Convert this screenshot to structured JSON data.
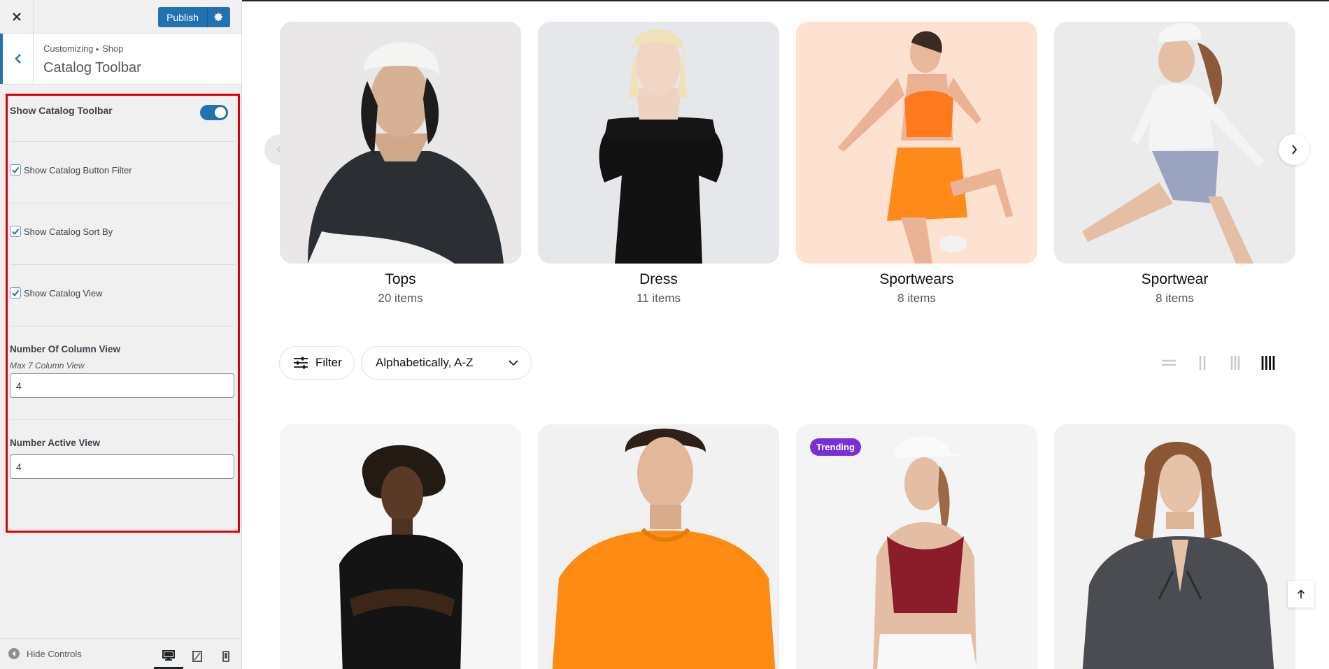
{
  "sidebar": {
    "publish_label": "Publish",
    "breadcrumb": {
      "root": "Customizing",
      "section": "Shop"
    },
    "section_title": "Catalog Toolbar",
    "controls": {
      "show_toolbar": {
        "label": "Show Catalog Toolbar",
        "enabled": true
      },
      "checkboxes": [
        {
          "label": "Show Catalog Button Filter",
          "checked": true
        },
        {
          "label": "Show Catalog Sort By",
          "checked": true
        },
        {
          "label": "Show Catalog View",
          "checked": true
        }
      ],
      "column_view": {
        "label": "Number Of Column View",
        "hint": "Max 7 Column View",
        "value": "4"
      },
      "active_view": {
        "label": "Number Active View",
        "value": "4"
      }
    },
    "footer": {
      "hide_controls_label": "Hide Controls"
    }
  },
  "categories": [
    {
      "name": "Tops",
      "count": "20 items"
    },
    {
      "name": "Dress",
      "count": "11 items"
    },
    {
      "name": "Sportwears",
      "count": "8 items"
    },
    {
      "name": "Sportwear",
      "count": "8 items"
    }
  ],
  "toolbar": {
    "filter_label": "Filter",
    "sort_value": "Alphabetically, A-Z",
    "active_view": 4
  },
  "products": [
    {
      "badge": ""
    },
    {
      "badge": ""
    },
    {
      "badge": "Trending"
    },
    {
      "badge": ""
    }
  ],
  "colors": {
    "accent": "#2271b1",
    "highlight_border": "#e0000a",
    "badge": "#7b2fd6"
  }
}
